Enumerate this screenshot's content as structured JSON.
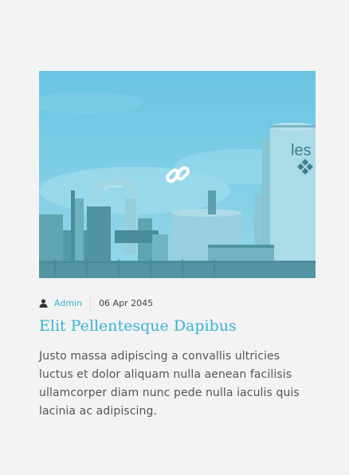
{
  "post": {
    "image": {
      "alt": "industrial plant",
      "overlay_icon": "link-icon",
      "overlay_color": "#39b3d7"
    },
    "meta": {
      "author_icon": "user-icon",
      "author": "Admin",
      "date": "06 Apr 2045"
    },
    "title": "Elit Pellentesque Dapibus",
    "excerpt": "Justo massa adipiscing a convallis ultricies luctus et dolor aliquam nulla aenean facilisis ullamcorper diam nunc pede nulla iaculis quis lacinia ac adipiscing.",
    "signage_text": "les"
  },
  "colors": {
    "accent": "#39b3d7",
    "background": "#f3f3f3",
    "text": "#555555"
  }
}
